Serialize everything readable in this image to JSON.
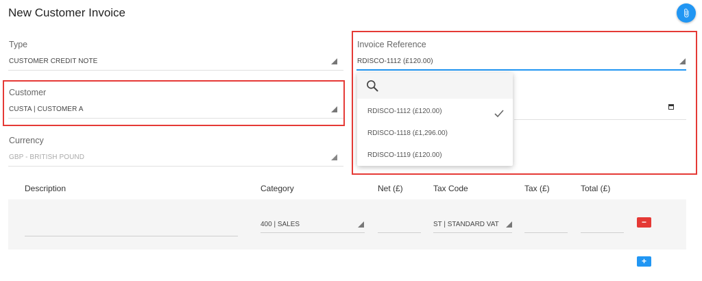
{
  "page": {
    "title": "New Customer Invoice"
  },
  "icons": {
    "attach": "paperclip-icon",
    "search": "search-icon",
    "check": "check-icon",
    "calendar": "calendar-icon"
  },
  "colors": {
    "accent": "#2196f3",
    "danger": "#e53935",
    "highlight": "#e53935"
  },
  "form": {
    "type": {
      "label": "Type",
      "value": "CUSTOMER CREDIT NOTE"
    },
    "customer": {
      "label": "Customer",
      "value": "CUSTA | CUSTOMER A"
    },
    "currency": {
      "label": "Currency",
      "value": "GBP - BRITISH POUND"
    },
    "invoice_reference": {
      "label": "Invoice Reference",
      "value": "RDISCO-1112 (£120.00)",
      "options": [
        "RDISCO-1112 (£120.00)",
        "RDISCO-1118 (£1,296.00)",
        "RDISCO-1119 (£120.00)"
      ],
      "selected": "RDISCO-1112 (£120.00)"
    }
  },
  "lines": {
    "headers": [
      "Description",
      "Category",
      "Net (£)",
      "Tax Code",
      "Tax (£)",
      "Total (£)"
    ],
    "row": {
      "description": "",
      "category": "400 | SALES",
      "net": "",
      "tax_code": "ST | STANDARD VAT",
      "tax": "",
      "total": ""
    },
    "remove_label": "−",
    "add_label": "+"
  }
}
